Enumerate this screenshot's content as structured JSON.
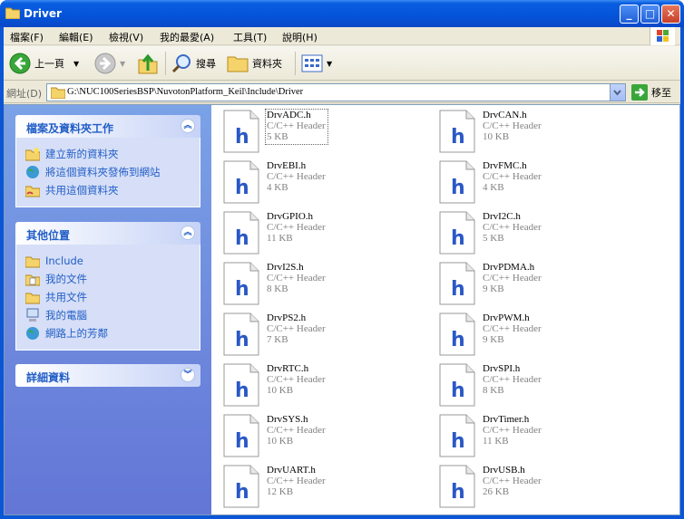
{
  "window": {
    "title": "Driver"
  },
  "menu": [
    "檔案(F)",
    "編輯(E)",
    "檢視(V)",
    "我的最愛(A)",
    "工具(T)",
    "說明(H)"
  ],
  "toolbar": {
    "back": "上一頁",
    "search": "搜尋",
    "folders": "資料夾"
  },
  "address": {
    "label": "網址(D)",
    "path": "G:\\NUC100SeriesBSP\\NuvotonPlatform_Keil\\Include\\Driver",
    "go": "移至"
  },
  "tasks": {
    "file_tasks": {
      "title": "檔案及資料夾工作",
      "items": [
        "建立新的資料夾",
        "將這個資料夾發佈到網站",
        "共用這個資料夾"
      ]
    },
    "other_places": {
      "title": "其他位置",
      "items": [
        "Include",
        "我的文件",
        "共用文件",
        "我的電腦",
        "網路上的芳鄰"
      ]
    },
    "details": {
      "title": "詳細資料"
    }
  },
  "files": [
    {
      "name": "DrvADC.h",
      "type": "C/C++ Header",
      "size": "5 KB"
    },
    {
      "name": "DrvCAN.h",
      "type": "C/C++ Header",
      "size": "10 KB"
    },
    {
      "name": "DrvEBI.h",
      "type": "C/C++ Header",
      "size": "4 KB"
    },
    {
      "name": "DrvFMC.h",
      "type": "C/C++ Header",
      "size": "4 KB"
    },
    {
      "name": "DrvGPIO.h",
      "type": "C/C++ Header",
      "size": "11 KB"
    },
    {
      "name": "DrvI2C.h",
      "type": "C/C++ Header",
      "size": "5 KB"
    },
    {
      "name": "DrvI2S.h",
      "type": "C/C++ Header",
      "size": "8 KB"
    },
    {
      "name": "DrvPDMA.h",
      "type": "C/C++ Header",
      "size": "9 KB"
    },
    {
      "name": "DrvPS2.h",
      "type": "C/C++ Header",
      "size": "7 KB"
    },
    {
      "name": "DrvPWM.h",
      "type": "C/C++ Header",
      "size": "9 KB"
    },
    {
      "name": "DrvRTC.h",
      "type": "C/C++ Header",
      "size": "10 KB"
    },
    {
      "name": "DrvSPI.h",
      "type": "C/C++ Header",
      "size": "8 KB"
    },
    {
      "name": "DrvSYS.h",
      "type": "C/C++ Header",
      "size": "10 KB"
    },
    {
      "name": "DrvTimer.h",
      "type": "C/C++ Header",
      "size": "11 KB"
    },
    {
      "name": "DrvUART.h",
      "type": "C/C++ Header",
      "size": "12 KB"
    },
    {
      "name": "DrvUSB.h",
      "type": "C/C++ Header",
      "size": "26 KB"
    }
  ],
  "file_icon_letter": "h"
}
